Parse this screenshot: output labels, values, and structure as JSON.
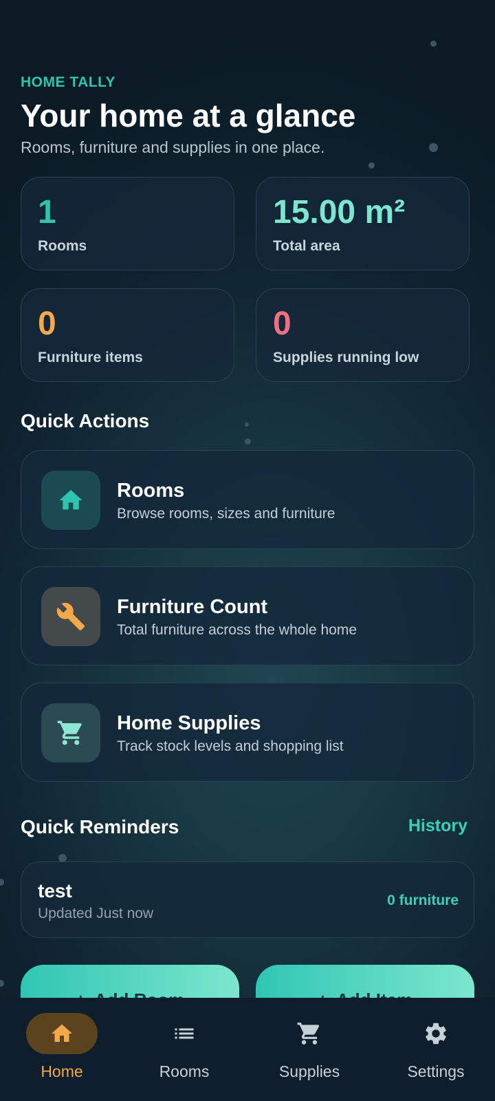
{
  "header": {
    "eyebrow": "HOME TALLY",
    "title": "Your home at a glance",
    "subtitle": "Rooms, furniture and supplies in one place."
  },
  "stats": [
    {
      "value": "1",
      "label": "Rooms",
      "color": "#2ec4b0"
    },
    {
      "value": "15.00 m²",
      "label": "Total area",
      "color": "#7de6cf"
    },
    {
      "value": "0",
      "label": "Furniture items",
      "color": "#f3a949"
    },
    {
      "value": "0",
      "label": "Supplies running low",
      "color": "#ef6f86"
    }
  ],
  "quick_actions": {
    "title": "Quick Actions",
    "items": [
      {
        "title": "Rooms",
        "description": "Browse rooms, sizes and furniture",
        "icon": "home-icon"
      },
      {
        "title": "Furniture Count",
        "description": "Total furniture across the whole home",
        "icon": "wrench-icon"
      },
      {
        "title": "Home Supplies",
        "description": "Track stock levels and shopping list",
        "icon": "cart-icon"
      }
    ]
  },
  "reminders": {
    "title": "Quick Reminders",
    "history_label": "History",
    "items": [
      {
        "name": "test",
        "updated": "Updated Just now",
        "count": "0 furniture"
      }
    ]
  },
  "buttons": {
    "add_room": "Add Room",
    "add_item": "Add Item"
  },
  "nav": {
    "items": [
      {
        "label": "Home",
        "icon": "home-icon",
        "active": true
      },
      {
        "label": "Rooms",
        "icon": "list-icon",
        "active": false
      },
      {
        "label": "Supplies",
        "icon": "cart-icon",
        "active": false
      },
      {
        "label": "Settings",
        "icon": "gear-icon",
        "active": false
      }
    ]
  },
  "colors": {
    "accent": "#2ec4b0",
    "warning": "#f3a949",
    "danger": "#ef6f86"
  }
}
